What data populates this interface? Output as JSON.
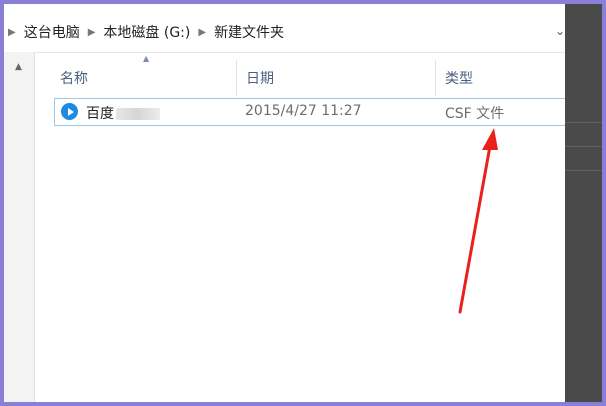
{
  "breadcrumb": {
    "items": [
      "这台电脑",
      "本地磁盘 (G:)",
      "新建文件夹"
    ]
  },
  "columns": {
    "name": "名称",
    "date": "日期",
    "type": "类型"
  },
  "files": [
    {
      "name": "百度",
      "date": "2015/4/27 11:27",
      "type": "CSF 文件",
      "icon": "baidu-player-icon"
    }
  ],
  "colors": {
    "selection_border": "#9cc8ef",
    "icon_blue": "#1f8ae0",
    "annotation_arrow": "#e8211b",
    "outer_border": "#8a7fd6"
  },
  "annotation": {
    "type": "red-arrow",
    "points_to": "files.0.type"
  }
}
